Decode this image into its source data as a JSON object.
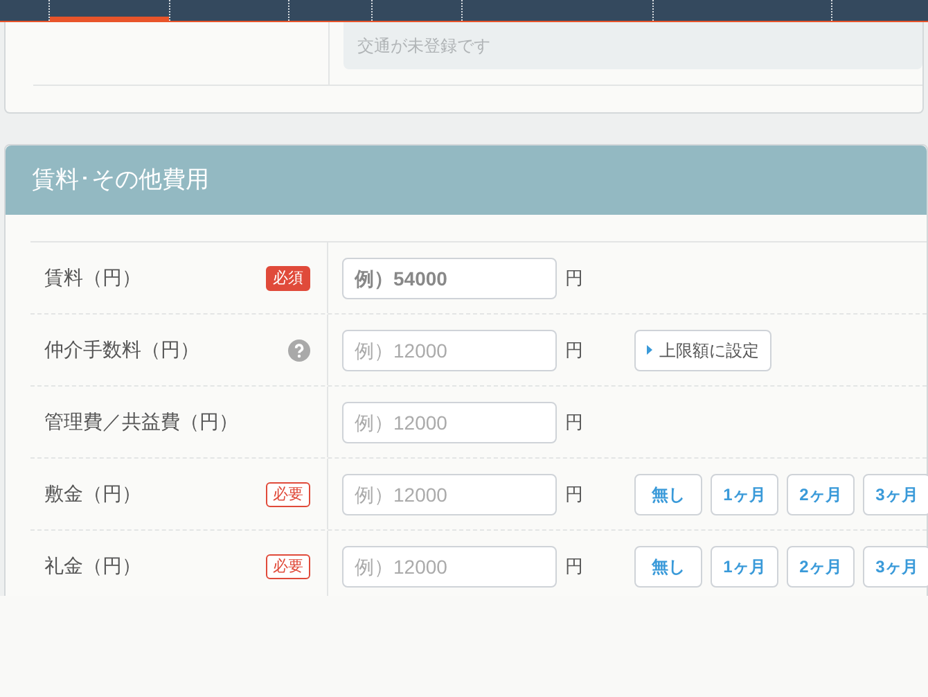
{
  "nav": {
    "tabs": [
      {
        "selected": true
      },
      {
        "selected": false
      },
      {
        "selected": false
      },
      {
        "selected": false
      },
      {
        "selected": false
      },
      {
        "selected": false
      },
      {
        "selected": false
      }
    ]
  },
  "transport": {
    "notice": "交通が未登録です"
  },
  "fees": {
    "title": "賃料･その他費用",
    "rows": [
      {
        "label": "賃料（円）",
        "badge": {
          "kind": "solid",
          "text": "必須"
        },
        "placeholder": "例）54000",
        "placeholder_bold": true,
        "unit": "円"
      },
      {
        "label": "仲介手数料（円）",
        "help": true,
        "placeholder": "例）12000",
        "placeholder_bold": false,
        "unit": "円",
        "actions": [
          {
            "kind": "link",
            "text": "上限額に設定"
          }
        ]
      },
      {
        "label": "管理費／共益費（円）",
        "placeholder": "例）12000",
        "placeholder_bold": false,
        "unit": "円"
      },
      {
        "label": "敷金（円）",
        "badge": {
          "kind": "outline",
          "text": "必要"
        },
        "placeholder": "例）12000",
        "placeholder_bold": false,
        "unit": "円",
        "actions": [
          {
            "kind": "preset",
            "text": "無し"
          },
          {
            "kind": "preset",
            "text": "1ヶ月"
          },
          {
            "kind": "preset",
            "text": "2ヶ月"
          },
          {
            "kind": "preset",
            "text": "3ヶ月"
          }
        ]
      },
      {
        "label": "礼金（円）",
        "badge": {
          "kind": "outline",
          "text": "必要"
        },
        "placeholder": "例）12000",
        "placeholder_bold": false,
        "unit": "円",
        "actions": [
          {
            "kind": "preset",
            "text": "無し"
          },
          {
            "kind": "preset",
            "text": "1ヶ月"
          },
          {
            "kind": "preset",
            "text": "2ヶ月"
          },
          {
            "kind": "preset",
            "text": "3ヶ月"
          }
        ]
      }
    ]
  }
}
